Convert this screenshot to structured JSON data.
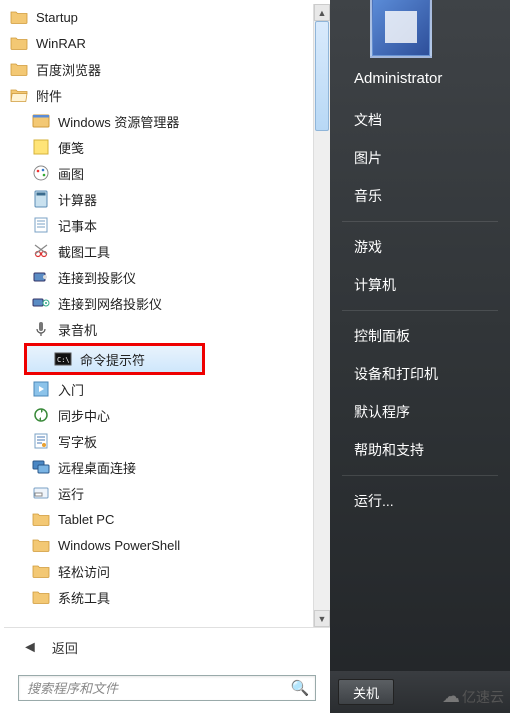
{
  "left": {
    "topFolders": [
      {
        "label": "Startup",
        "icon": "folder"
      },
      {
        "label": "WinRAR",
        "icon": "folder"
      },
      {
        "label": "百度浏览器",
        "icon": "folder"
      },
      {
        "label": "附件",
        "icon": "folder-open"
      }
    ],
    "accessories": [
      {
        "label": "Windows 资源管理器",
        "icon": "explorer"
      },
      {
        "label": "便笺",
        "icon": "sticky"
      },
      {
        "label": "画图",
        "icon": "paint"
      },
      {
        "label": "计算器",
        "icon": "calc"
      },
      {
        "label": "记事本",
        "icon": "notepad"
      },
      {
        "label": "截图工具",
        "icon": "snip"
      },
      {
        "label": "连接到投影仪",
        "icon": "projector"
      },
      {
        "label": "连接到网络投影仪",
        "icon": "netproj"
      },
      {
        "label": "录音机",
        "icon": "recorder"
      },
      {
        "label": "命令提示符",
        "icon": "cmd",
        "highlighted": true,
        "selected": true
      },
      {
        "label": "入门",
        "icon": "getstarted"
      },
      {
        "label": "同步中心",
        "icon": "sync"
      },
      {
        "label": "写字板",
        "icon": "wordpad"
      },
      {
        "label": "远程桌面连接",
        "icon": "rdp"
      },
      {
        "label": "运行",
        "icon": "run"
      },
      {
        "label": "Tablet PC",
        "icon": "folder"
      },
      {
        "label": "Windows PowerShell",
        "icon": "folder"
      },
      {
        "label": "轻松访问",
        "icon": "folder"
      },
      {
        "label": "系统工具",
        "icon": "folder"
      }
    ],
    "back": "返回",
    "searchPlaceholder": "搜索程序和文件"
  },
  "right": {
    "user": "Administrator",
    "groups": [
      [
        "文档",
        "图片",
        "音乐"
      ],
      [
        "游戏",
        "计算机"
      ],
      [
        "控制面板",
        "设备和打印机",
        "默认程序",
        "帮助和支持"
      ],
      [
        "运行..."
      ]
    ],
    "shutdown": "关机"
  },
  "watermark": "亿速云"
}
